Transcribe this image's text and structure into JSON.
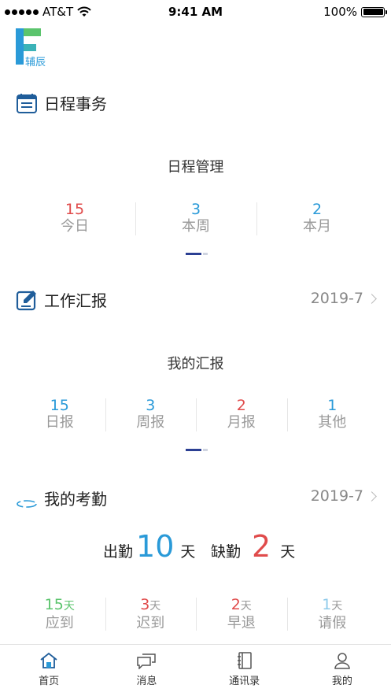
{
  "status_bar": {
    "carrier": "AT&T",
    "time": "9:41 AM",
    "battery": "100%"
  },
  "logo": {
    "text": "辅辰"
  },
  "schedule": {
    "title": "日程事务",
    "subtitle": "日程管理",
    "stats": [
      {
        "value": "15",
        "label": "今日"
      },
      {
        "value": "3",
        "label": "本周"
      },
      {
        "value": "2",
        "label": "本月"
      }
    ]
  },
  "report": {
    "title": "工作汇报",
    "date": "2019-7",
    "subtitle": "我的汇报",
    "stats": [
      {
        "value": "15",
        "label": "日报"
      },
      {
        "value": "3",
        "label": "周报"
      },
      {
        "value": "2",
        "label": "月报"
      },
      {
        "value": "1",
        "label": "其他"
      }
    ]
  },
  "attendance": {
    "title": "我的考勤",
    "date": "2019-7",
    "present_label": "出勤",
    "present_value": "10",
    "absent_label": "缺勤",
    "absent_value": "2",
    "unit": "天",
    "stats": [
      {
        "value": "15",
        "unit": "天",
        "label": "应到"
      },
      {
        "value": "3",
        "unit": "天",
        "label": "迟到"
      },
      {
        "value": "2",
        "unit": "天",
        "label": "早退"
      },
      {
        "value": "1",
        "unit": "天",
        "label": "请假"
      }
    ]
  },
  "tabbar": {
    "items": [
      {
        "label": "首页",
        "icon": "home-icon"
      },
      {
        "label": "消息",
        "icon": "message-icon"
      },
      {
        "label": "通讯录",
        "icon": "contacts-icon"
      },
      {
        "label": "我的",
        "icon": "user-icon"
      }
    ]
  },
  "colors": {
    "red": "#e04b4b",
    "blue": "#2a9ad8",
    "green": "#5bc46d",
    "light_blue": "#8ecaea",
    "navy": "#2b3f93"
  }
}
